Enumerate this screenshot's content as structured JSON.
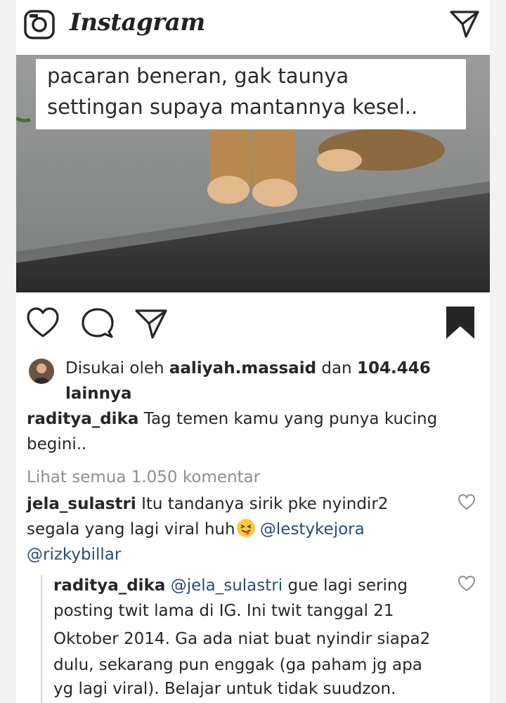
{
  "app": {
    "logo": "Instagram"
  },
  "post": {
    "image_caption_line1": "pacaran beneran, gak taunya",
    "image_caption_line2": "settingan supaya mantannya kesel..",
    "likes": {
      "prefix": "Disukai oleh",
      "user": "aaliyah.massaid",
      "connector": "dan",
      "count": "104.446",
      "suffix": "lainnya"
    },
    "author": "raditya_dika",
    "caption_line1": "Tag temen kamu yang punya kucing",
    "caption_line2": "begini..",
    "view_all_comments": "Lihat semua 1.050 komentar"
  },
  "comments": [
    {
      "user": "jela_sulastri",
      "line1": "Itu tandanya sirik pke nyindir2",
      "line2": "segala  yang lagi viral huh",
      "mention1": "@lestykejora",
      "mention2": "@rizkybillar"
    }
  ],
  "reply": {
    "user": "raditya_dika",
    "mention": "@jela_sulastri",
    "line1_rest": "gue lagi sering",
    "line2": "posting twit lama di IG. Ini twit tanggal  21",
    "line3": "Oktober 2014. Ga ada niat buat nyindir siapa2",
    "line4": "dulu, sekarang pun enggak (ga paham jg apa",
    "line5": "yg lagi viral). Belajar untuk tidak suudzon."
  },
  "icons": {
    "camera": "camera-icon",
    "direct": "paper-plane-icon",
    "like": "heart-icon",
    "comment": "speech-bubble-icon",
    "share": "paper-plane-icon",
    "save": "bookmark-icon",
    "emoji": "squinting-tongue-emoji"
  }
}
